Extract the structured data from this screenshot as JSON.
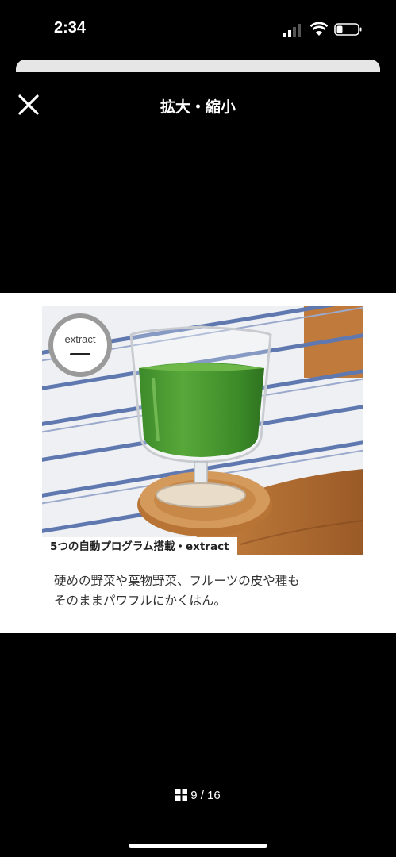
{
  "status_bar": {
    "time": "2:34"
  },
  "viewer": {
    "title": "拡大・縮小"
  },
  "image": {
    "badge": "extract",
    "caption": "5つの自動プログラム搭載・extract",
    "description_lines": [
      "硬めの野菜や葉物野菜、フルーツの皮や種も",
      "そのままパワフルにかくはん。"
    ]
  },
  "pager": {
    "current": "9",
    "separator": "/",
    "total": "16"
  }
}
